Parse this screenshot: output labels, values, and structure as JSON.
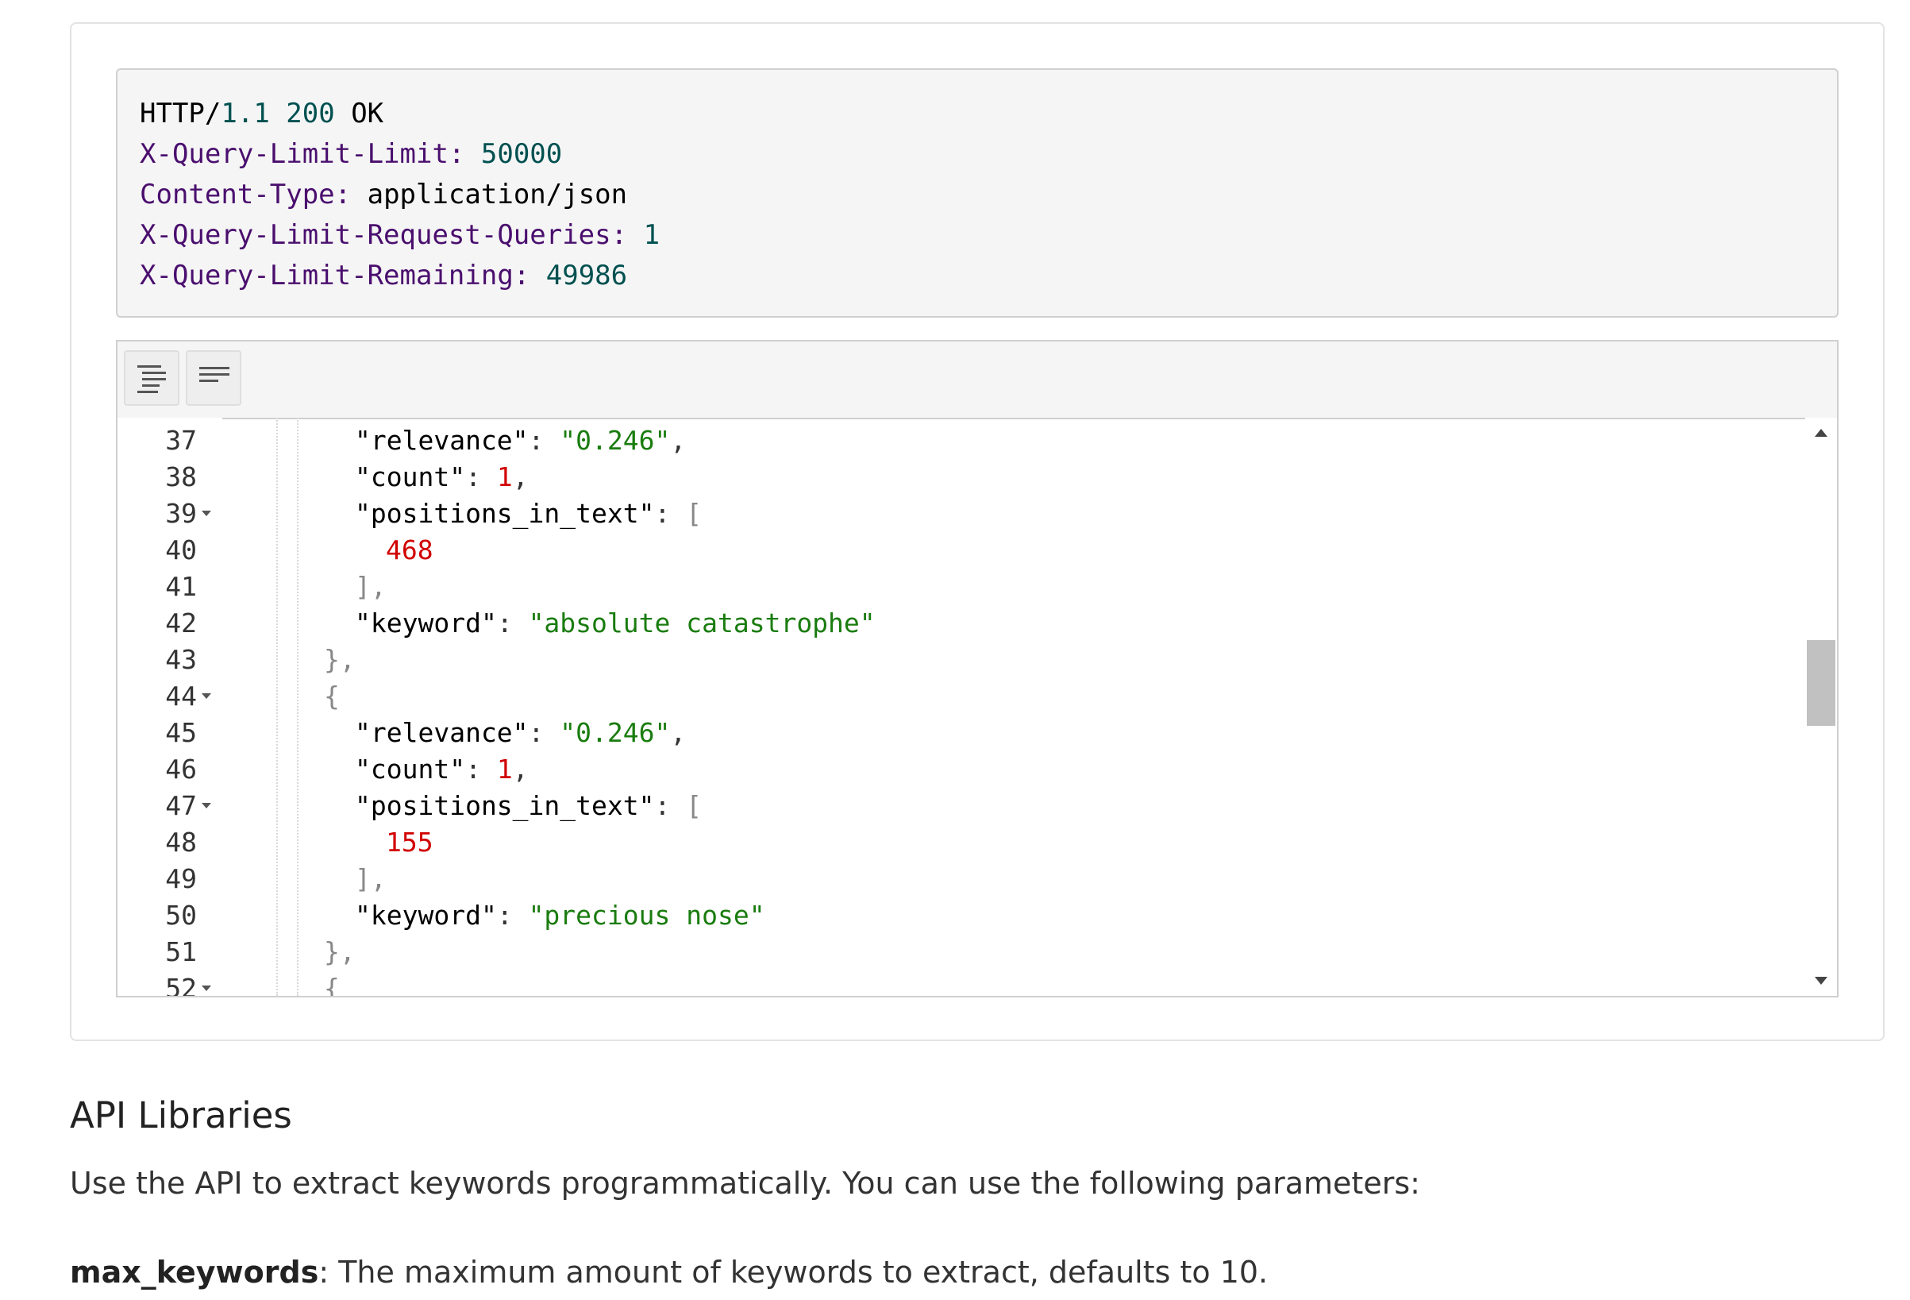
{
  "response_headers": {
    "status": {
      "proto": "HTTP",
      "slash": "/",
      "version": "1.1",
      "code": "200",
      "text": "OK"
    },
    "lines": [
      {
        "name": "X-Query-Limit-Limit",
        "sep": ": ",
        "value": "50000"
      },
      {
        "name": "Content-Type",
        "sep": ": ",
        "value": "application/json"
      },
      {
        "name": "X-Query-Limit-Request-Queries",
        "sep": ": ",
        "value": "1"
      },
      {
        "name": "X-Query-Limit-Remaining",
        "sep": ": ",
        "value": "49986"
      }
    ]
  },
  "editor": {
    "format_button": "format-icon",
    "compact_button": "compact-icon",
    "lines": [
      {
        "num": "37",
        "key": "\"relevance\"",
        "value": "\"0.246\"",
        "kind": "string",
        "tail": ","
      },
      {
        "num": "38",
        "key": "\"count\"",
        "value": "1",
        "kind": "number",
        "tail": ","
      },
      {
        "num": "39",
        "key": "\"positions_in_text\"",
        "value": "[",
        "kind": "bracket",
        "tail": ""
      },
      {
        "num": "40",
        "value": "468",
        "kind": "number"
      },
      {
        "num": "41",
        "value": "],",
        "kind": "bracket"
      },
      {
        "num": "42",
        "key": "\"keyword\"",
        "value": "\"absolute catastrophe\"",
        "kind": "string",
        "tail": ""
      },
      {
        "num": "43",
        "value": "},",
        "kind": "bracket"
      },
      {
        "num": "44",
        "value": "{",
        "kind": "bracket"
      },
      {
        "num": "45",
        "key": "\"relevance\"",
        "value": "\"0.246\"",
        "kind": "string",
        "tail": ","
      },
      {
        "num": "46",
        "key": "\"count\"",
        "value": "1",
        "kind": "number",
        "tail": ","
      },
      {
        "num": "47",
        "key": "\"positions_in_text\"",
        "value": "[",
        "kind": "bracket",
        "tail": ""
      },
      {
        "num": "48",
        "value": "155",
        "kind": "number"
      },
      {
        "num": "49",
        "value": "],",
        "kind": "bracket"
      },
      {
        "num": "50",
        "key": "\"keyword\"",
        "value": "\"precious nose\"",
        "kind": "string",
        "tail": ""
      },
      {
        "num": "51",
        "value": "},",
        "kind": "bracket"
      },
      {
        "num": "52",
        "value": "{",
        "kind": "bracket"
      }
    ]
  },
  "section_title": "API Libraries",
  "intro_text": "Use the API to extract keywords programmatically. You can use the following parameters:",
  "param": {
    "name": "max_keywords",
    "desc": ": The maximum amount of keywords to extract, defaults to 10."
  }
}
